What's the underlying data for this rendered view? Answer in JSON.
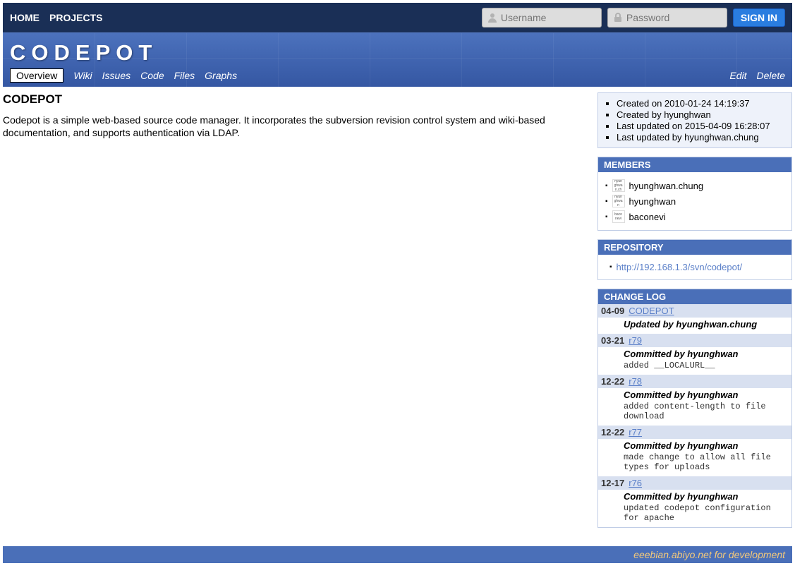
{
  "topbar": {
    "home": "HOME",
    "projects": "PROJECTS",
    "username_placeholder": "Username",
    "password_placeholder": "Password",
    "signin": "SIGN IN"
  },
  "header": {
    "title": "CODEPOT",
    "tabs": {
      "overview": "Overview",
      "wiki": "Wiki",
      "issues": "Issues",
      "code": "Code",
      "files": "Files",
      "graphs": "Graphs"
    },
    "actions": {
      "edit": "Edit",
      "delete": "Delete"
    }
  },
  "main": {
    "title": "CODEPOT",
    "description": "Codepot is a simple web-based source code manager. It incorporates the subversion revision control system and wiki-based documentation, and supports authentication via LDAP."
  },
  "meta": {
    "created_on": "Created on 2010-01-24 14:19:37",
    "created_by": "Created by hyunghwan",
    "updated_on": "Last updated on 2015-04-09 16:28:07",
    "updated_by": "Last updated by hyunghwan.chung"
  },
  "members": {
    "header": "MEMBERS",
    "items": [
      {
        "avatar": "hyun\nghwa\nn.ch",
        "name": "hyunghwan.chung"
      },
      {
        "avatar": "hyun\nghwa\nn",
        "name": "hyunghwan"
      },
      {
        "avatar": "baco\nnevi",
        "name": "baconevi"
      }
    ]
  },
  "repository": {
    "header": "REPOSITORY",
    "url": "http://192.168.1.3/svn/codepot/"
  },
  "changelog": {
    "header": "CHANGE LOG",
    "entries": [
      {
        "date": "04-09",
        "rev": "CODEPOT",
        "by": "Updated by hyunghwan.chung",
        "msg": ""
      },
      {
        "date": "03-21",
        "rev": "r79",
        "by": "Committed by hyunghwan",
        "msg": "added __LOCALURL__"
      },
      {
        "date": "12-22",
        "rev": "r78",
        "by": "Committed by hyunghwan",
        "msg": "added content-length to file download"
      },
      {
        "date": "12-22",
        "rev": "r77",
        "by": "Committed by hyunghwan",
        "msg": "made change to allow all file types for uploads"
      },
      {
        "date": "12-17",
        "rev": "r76",
        "by": "Committed by hyunghwan",
        "msg": "updated codepot configuration for apache"
      }
    ]
  },
  "footer": "eeebian.abiyo.net for development"
}
